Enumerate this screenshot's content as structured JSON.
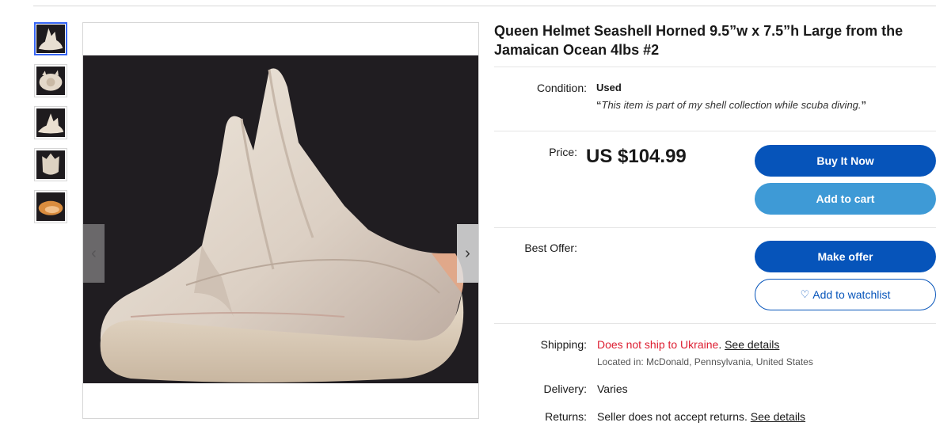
{
  "listing": {
    "title": "Queen Helmet Seashell Horned 9.5”w x 7.5”h Large from the Jamaican Ocean 4lbs #2"
  },
  "gallery": {
    "thumbnails": [
      "shell-thumb-1",
      "shell-thumb-2",
      "shell-thumb-3",
      "shell-thumb-4",
      "shell-thumb-5"
    ],
    "active_index": 0,
    "prev_icon": "‹",
    "next_icon": "›"
  },
  "condition": {
    "label": "Condition:",
    "value": "Used",
    "note_open": "“",
    "note": "This item is part of my shell collection while scuba diving.",
    "note_close": "”"
  },
  "price": {
    "label": "Price:",
    "value": "US $104.99"
  },
  "buttons": {
    "buy_now": "Buy It Now",
    "add_to_cart": "Add to cart",
    "make_offer": "Make offer",
    "watchlist": "Add to watchlist",
    "watchlist_icon": "♡"
  },
  "best_offer": {
    "label": "Best Offer:"
  },
  "shipping": {
    "label": "Shipping:",
    "status": "Does not ship to Ukraine",
    "punct": ".",
    "details_link": "See details",
    "location": "Located in: McDonald, Pennsylvania, United States"
  },
  "delivery": {
    "label": "Delivery:",
    "value": "Varies"
  },
  "returns": {
    "label": "Returns:",
    "value": "Seller does not accept returns.",
    "details_link": "See details"
  },
  "colors": {
    "primary_button": "#0654ba",
    "secondary_button": "#3e9ad6",
    "alert_red": "#dd1e31"
  }
}
